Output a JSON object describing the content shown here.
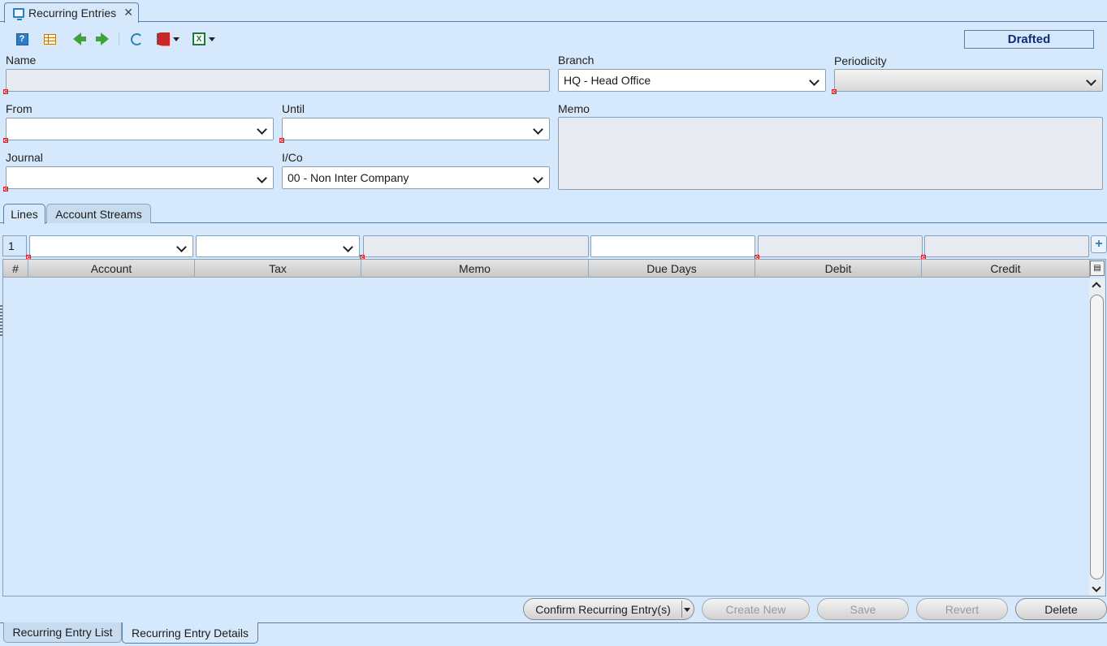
{
  "window": {
    "tab_title": "Recurring Entries",
    "close_symbol": "✕"
  },
  "toolbar": {
    "help_label": "?",
    "excel_label": "X"
  },
  "status": "Drafted",
  "form": {
    "name_label": "Name",
    "name_value": "",
    "branch_label": "Branch",
    "branch_value": "HQ - Head Office",
    "periodicity_label": "Periodicity",
    "periodicity_value": "",
    "from_label": "From",
    "from_value": "",
    "until_label": "Until",
    "until_value": "",
    "memo_label": "Memo",
    "memo_value": "",
    "journal_label": "Journal",
    "journal_value": "",
    "ico_label": "I/Co",
    "ico_value": "00 - Non Inter Company"
  },
  "inner_tabs": [
    "Lines",
    "Account Streams"
  ],
  "line_entry": {
    "row_number": "1",
    "add_symbol": "+"
  },
  "grid": {
    "columns": [
      "#",
      "Account",
      "Tax",
      "Memo",
      "Due Days",
      "Debit",
      "Credit"
    ],
    "rows": []
  },
  "actions": {
    "confirm": "Confirm Recurring Entry(s)",
    "create_new": "Create New",
    "save": "Save",
    "revert": "Revert",
    "delete": "Delete"
  },
  "bottom_tabs": [
    "Recurring Entry List",
    "Recurring Entry Details"
  ]
}
